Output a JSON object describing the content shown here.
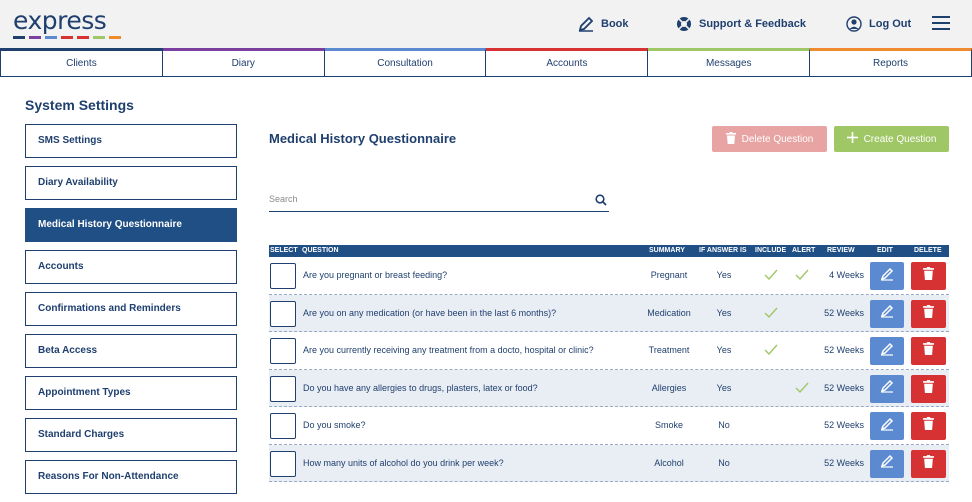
{
  "app": {
    "logo_text": "express",
    "logo_colors": [
      "#1f3f6e",
      "#7b3fa0",
      "#5b8ad0",
      "#d63233",
      "#d63233",
      "#9fc766",
      "#f08a2e"
    ]
  },
  "header": {
    "book_label": "Book",
    "support_label": "Support & Feedback",
    "logout_label": "Log Out"
  },
  "nav": {
    "tabs": [
      {
        "label": "Clients",
        "color": "#1f3f6e"
      },
      {
        "label": "Diary",
        "color": "#7b3fa0"
      },
      {
        "label": "Consultation",
        "color": "#5b8ad0"
      },
      {
        "label": "Accounts",
        "color": "#d63233"
      },
      {
        "label": "Messages",
        "color": "#9fc766"
      },
      {
        "label": "Reports",
        "color": "#f08a2e"
      }
    ]
  },
  "sidebar": {
    "title": "System Settings",
    "items": [
      {
        "label": "SMS Settings",
        "active": false
      },
      {
        "label": "Diary Availability",
        "active": false
      },
      {
        "label": "Medical History Questionnaire",
        "active": true
      },
      {
        "label": "Accounts",
        "active": false
      },
      {
        "label": "Confirmations and Reminders",
        "active": false
      },
      {
        "label": "Beta Access",
        "active": false
      },
      {
        "label": "Appointment Types",
        "active": false
      },
      {
        "label": "Standard Charges",
        "active": false
      },
      {
        "label": "Reasons For Non-Attendance",
        "active": false
      }
    ]
  },
  "main": {
    "title": "Medical History Questionnaire",
    "delete_label": "Delete Question",
    "create_label": "Create Question",
    "search_placeholder": "Search"
  },
  "table": {
    "headers": {
      "select": "SELECT",
      "question": "QUESTION",
      "summary": "SUMMARY",
      "if_answer": "IF ANSWER IS",
      "include": "INCLUDE",
      "alert": "ALERT",
      "review": "REVIEW",
      "edit": "EDIT",
      "delete": "DELETE"
    },
    "rows": [
      {
        "question": "Are you pregnant or breast feeding?",
        "summary": "Pregnant",
        "answer": "Yes",
        "include": true,
        "alert": true,
        "review": "4 Weeks"
      },
      {
        "question": "Are you on any medication (or have been in the last 6 months)?",
        "summary": "Medication",
        "answer": "Yes",
        "include": true,
        "alert": false,
        "review": "52 Weeks"
      },
      {
        "question": "Are you currently receiving any treatment from a docto, hospital or clinic?",
        "summary": "Treatment",
        "answer": "Yes",
        "include": true,
        "alert": false,
        "review": "52 Weeks"
      },
      {
        "question": "Do you have any allergies to drugs, plasters, latex or food?",
        "summary": "Allergies",
        "answer": "Yes",
        "include": false,
        "alert": true,
        "review": "52 Weeks"
      },
      {
        "question": "Do you smoke?",
        "summary": "Smoke",
        "answer": "No",
        "include": false,
        "alert": false,
        "review": "52 Weeks"
      },
      {
        "question": "How many units of alcohol do you drink per week?",
        "summary": "Alcohol",
        "answer": "No",
        "include": false,
        "alert": false,
        "review": "52 Weeks"
      }
    ]
  }
}
